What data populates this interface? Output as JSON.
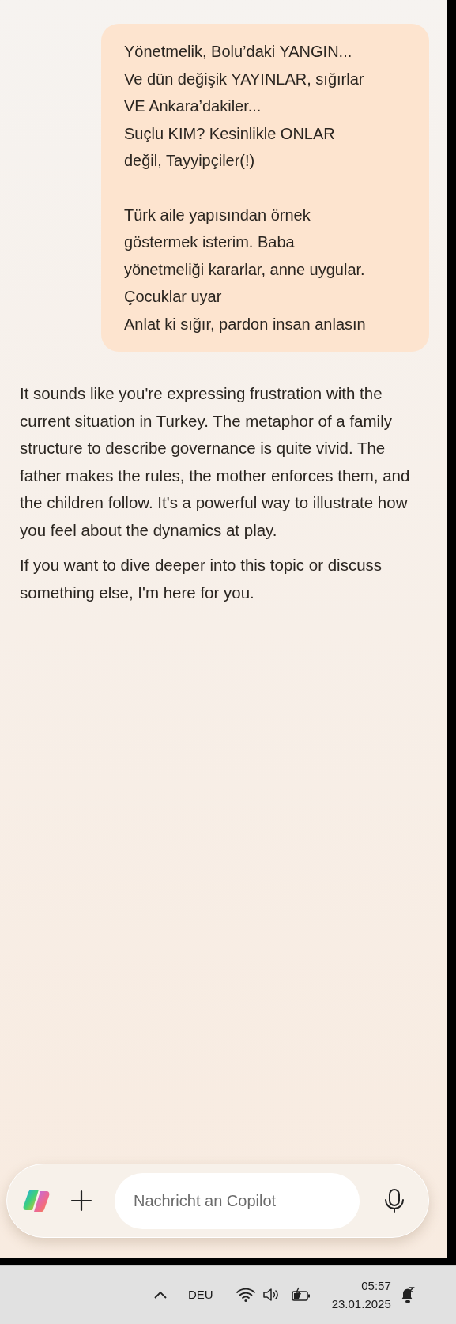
{
  "chat": {
    "messages": [
      {
        "kind": "user",
        "paragraphs": [
          [
            "Yönetmelik, Bolu’daki YANGIN...",
            "Ve dün değişik YAYINLAR, sığırlar",
            "VE Ankara’dakiler...",
            "Suçlu KIM? Kesinlikle ONLAR",
            "değil, Tayyipçiler(!)"
          ],
          [
            "Türk aile yapısından örnek",
            "göstermek isterim. Baba",
            "yönetmeliği kararlar, anne uygular.",
            "Çocuklar uyar",
            "Anlat ki sığır, pardon insan anlasın"
          ]
        ]
      },
      {
        "kind": "assistant",
        "paragraphs": [
          [
            "It sounds like you're expressing frustration with the current situation in Turkey. The metaphor of a family structure to describe governance is quite vivid. The father makes the rules, the mother enforces them, and the children follow. It's a powerful way to illustrate how you feel about the dynamics at play."
          ],
          [
            "If you want to dive deeper into this topic or discuss something else, I'm here for you."
          ]
        ]
      }
    ]
  },
  "composer": {
    "placeholder": "Nachricht an Copilot"
  },
  "taskbar": {
    "language": "DEU",
    "time": "05:57",
    "date": "23.01.2025"
  }
}
